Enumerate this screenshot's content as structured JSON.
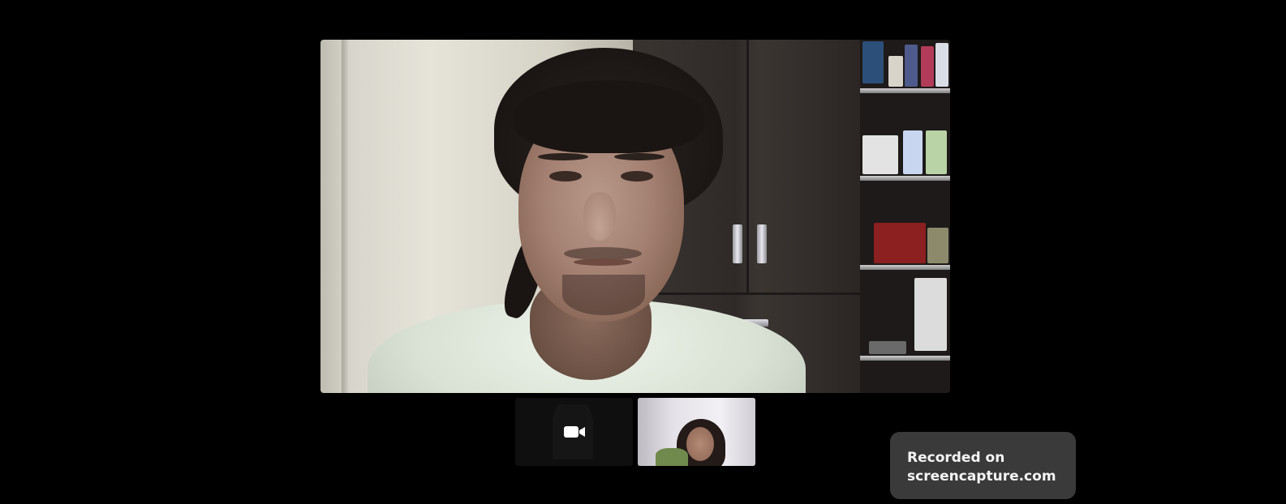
{
  "main_video": {
    "participant_icon": "person-video-feed"
  },
  "thumbnails": [
    {
      "kind": "camera-off",
      "icon": "video-camera-icon",
      "avatar_icon": "person-silhouette-icon"
    },
    {
      "kind": "video",
      "icon": "person-video-feed"
    }
  ],
  "watermark": {
    "line1": "Recorded on",
    "line2": "screencapture.com"
  },
  "colors": {
    "background": "#000000",
    "watermark_bg": "#3a3a3a",
    "watermark_text": "#f4f4f4"
  }
}
